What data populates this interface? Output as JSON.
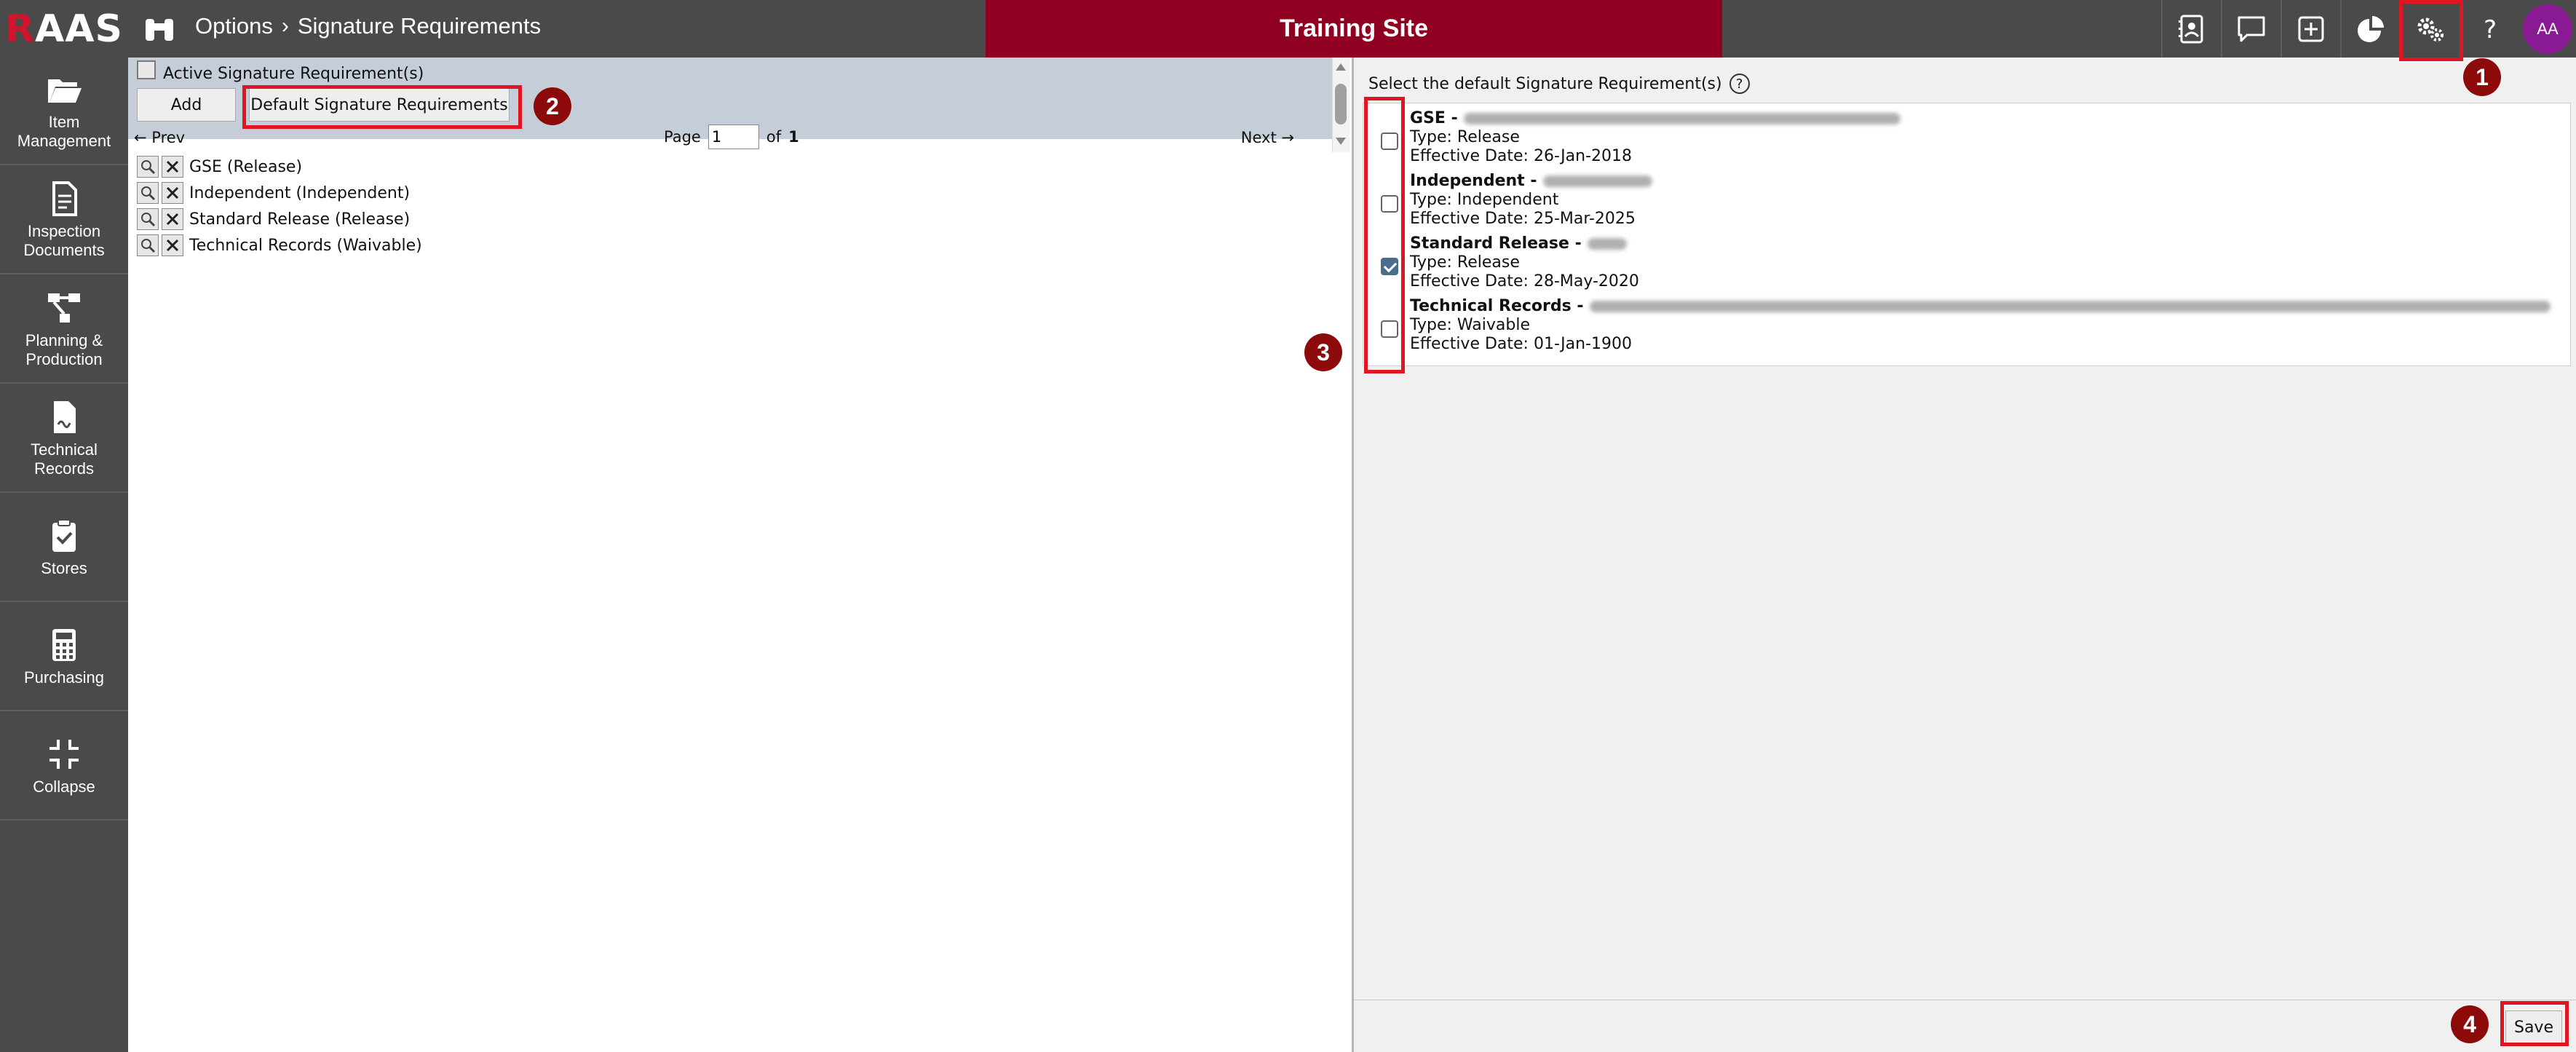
{
  "app": {
    "logo_text_r": "R",
    "logo_text_rest": "AAS",
    "brand_color": "#900020"
  },
  "header": {
    "breadcrumb_parent": "Options",
    "breadcrumb_separator": "›",
    "breadcrumb_current": "Signature Requirements",
    "site_name": "Training Site",
    "icons": [
      "contact-card-icon",
      "chat-icon",
      "add-square-icon",
      "pie-chart-icon",
      "gears-icon",
      "help-icon"
    ],
    "user_initials": "AA"
  },
  "sidebar": {
    "items": [
      {
        "label": "Item\nManagement",
        "icon": "folder-open-icon"
      },
      {
        "label": "Inspection\nDocuments",
        "icon": "document-list-icon"
      },
      {
        "label": "Planning &\nProduction",
        "icon": "flow-icon"
      },
      {
        "label": "Technical\nRecords",
        "icon": "signed-document-icon"
      },
      {
        "label": "Stores",
        "icon": "clipboard-check-icon"
      },
      {
        "label": "Purchasing",
        "icon": "calculator-icon"
      },
      {
        "label": "Collapse",
        "icon": "collapse-icon"
      }
    ]
  },
  "left_panel": {
    "title": "Active Signature Requirement(s)",
    "add_label": "Add",
    "default_label": "Default Signature Requirements",
    "prev_label": "← Prev",
    "page_label": "Page",
    "page_value": "1",
    "of_label": "of",
    "total_pages": "1",
    "next_label": "Next →",
    "requirements": [
      "GSE (Release)",
      "Independent (Independent)",
      "Standard Release (Release)",
      "Technical Records (Waivable)"
    ]
  },
  "right_panel": {
    "title": "Select the default Signature Requirement(s)",
    "help_glyph": "?",
    "defaults": [
      {
        "name": "GSE -",
        "type": "Type: Release",
        "date": "Effective Date: 26-Jan-2018",
        "checked": false
      },
      {
        "name": "Independent -",
        "type": "Type: Independent",
        "date": "Effective Date: 25-Mar-2025",
        "checked": false
      },
      {
        "name": "Standard Release -",
        "type": "Type: Release",
        "date": "Effective Date: 28-May-2020",
        "checked": true
      },
      {
        "name": "Technical Records -",
        "type": "Type: Waivable",
        "date": "Effective Date: 01-Jan-1900",
        "checked": false
      }
    ],
    "save_label": "Save"
  },
  "annotations": {
    "markers": [
      "1",
      "2",
      "3",
      "4"
    ],
    "highlight_color": "#e01522",
    "marker_color": "#8c0a0a"
  }
}
